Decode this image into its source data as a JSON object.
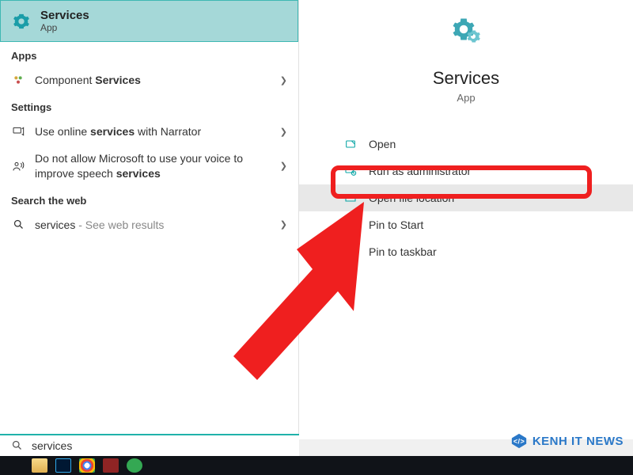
{
  "best_match": {
    "title": "Services",
    "subtitle": "App"
  },
  "sections": {
    "apps_header": "Apps",
    "apps": [
      {
        "label_before": "Component ",
        "label_bold": "Services",
        "label_after": ""
      }
    ],
    "settings_header": "Settings",
    "settings": [
      {
        "label_before": "Use online ",
        "label_bold": "services",
        "label_after": " with Narrator"
      },
      {
        "label_before": "Do not allow Microsoft to use your voice to improve speech ",
        "label_bold": "services",
        "label_after": ""
      }
    ],
    "web_header": "Search the web",
    "web": [
      {
        "query": "services",
        "suffix": " - See web results"
      }
    ]
  },
  "detail": {
    "title": "Services",
    "subtitle": "App",
    "menu": [
      {
        "label": "Open"
      },
      {
        "label": "Run as administrator"
      },
      {
        "label": "Open file location"
      },
      {
        "label": "Pin to Start"
      },
      {
        "label": "Pin to taskbar"
      }
    ]
  },
  "search": {
    "value": "services",
    "placeholder": ""
  },
  "watermark": "KENH IT NEWS"
}
